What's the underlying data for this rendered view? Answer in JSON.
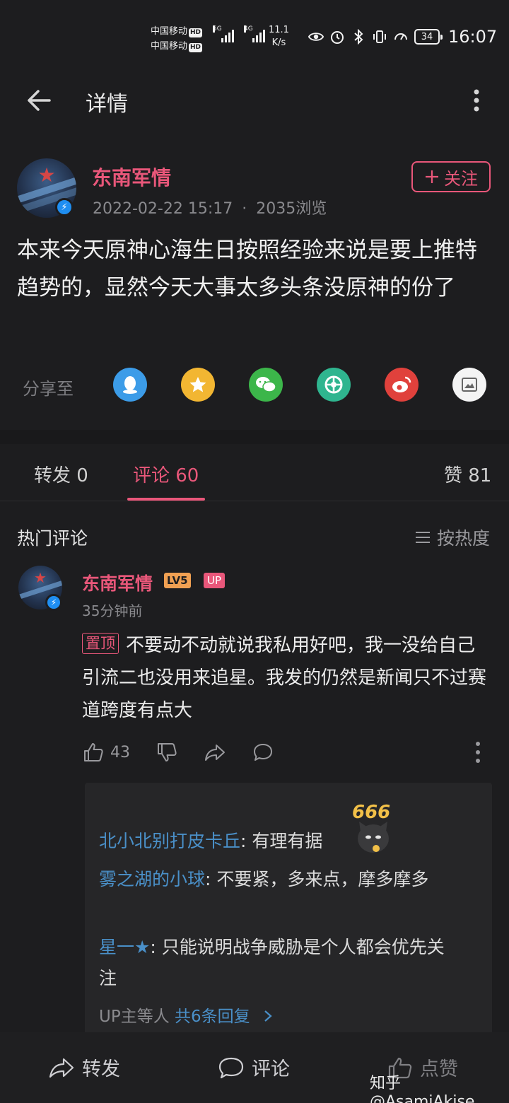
{
  "status_bar": {
    "carrier1": "中国移动",
    "carrier2": "中国移动",
    "hd": "HD",
    "sig1_tag": "5G",
    "sig2_tag": "4G",
    "net_speed_value": "11.1",
    "net_speed_unit": "K/s",
    "battery": "34",
    "time": "16:07"
  },
  "top_bar": {
    "title": "详情"
  },
  "post": {
    "author": "东南军情",
    "timestamp": "2022-02-22 15:17",
    "separator": "·",
    "views": "2035浏览",
    "follow_label": "关注",
    "body": "本来今天原神心海生日按照经验来说是要上推特趋势的，显然今天大事太多头条没原神的份了"
  },
  "share": {
    "label": "分享至",
    "targets": [
      {
        "icon": "qq-icon",
        "color": "#3c9ce8"
      },
      {
        "icon": "qzone-icon",
        "color": "#f2b632"
      },
      {
        "icon": "wechat-icon",
        "color": "#3cb64a"
      },
      {
        "icon": "moments-icon",
        "color": "#2fb58f"
      },
      {
        "icon": "weibo-icon",
        "color": "#e0413c"
      },
      {
        "icon": "save-image-icon",
        "color": "#f4f4f4"
      }
    ]
  },
  "tabs": {
    "repost": "转发 0",
    "comment": "评论 60",
    "like": "赞 81"
  },
  "comments": {
    "section_title": "热门评论",
    "sort_label": "按热度",
    "top_comment": {
      "author": "东南军情",
      "level": "LV5",
      "up_badge": "UP",
      "time": "35分钟前",
      "pinned_label": "置顶",
      "body": "不要动不动就说我私用好吧，我一没给自己引流二也没用来追星。我发的仍然是新闻只不过赛道跨度有点大",
      "like_count": "43"
    },
    "replies": [
      {
        "who": "北小北别打皮卡丘",
        "text": ": 有理有据"
      },
      {
        "who": "雾之湖的小球",
        "text": ": 不要紧，多来点，摩多摩多"
      },
      {
        "who": "星一★",
        "text": ": 只能说明战争威胁是个人都会优先关注"
      }
    ],
    "sticker_text": "666",
    "more_prefix": "UP主等人 ",
    "more_link": "共6条回复"
  },
  "bottom_bar": {
    "repost": "转发",
    "comment": "评论",
    "like": "点赞"
  },
  "watermark": "知乎 @AsamiAkise"
}
